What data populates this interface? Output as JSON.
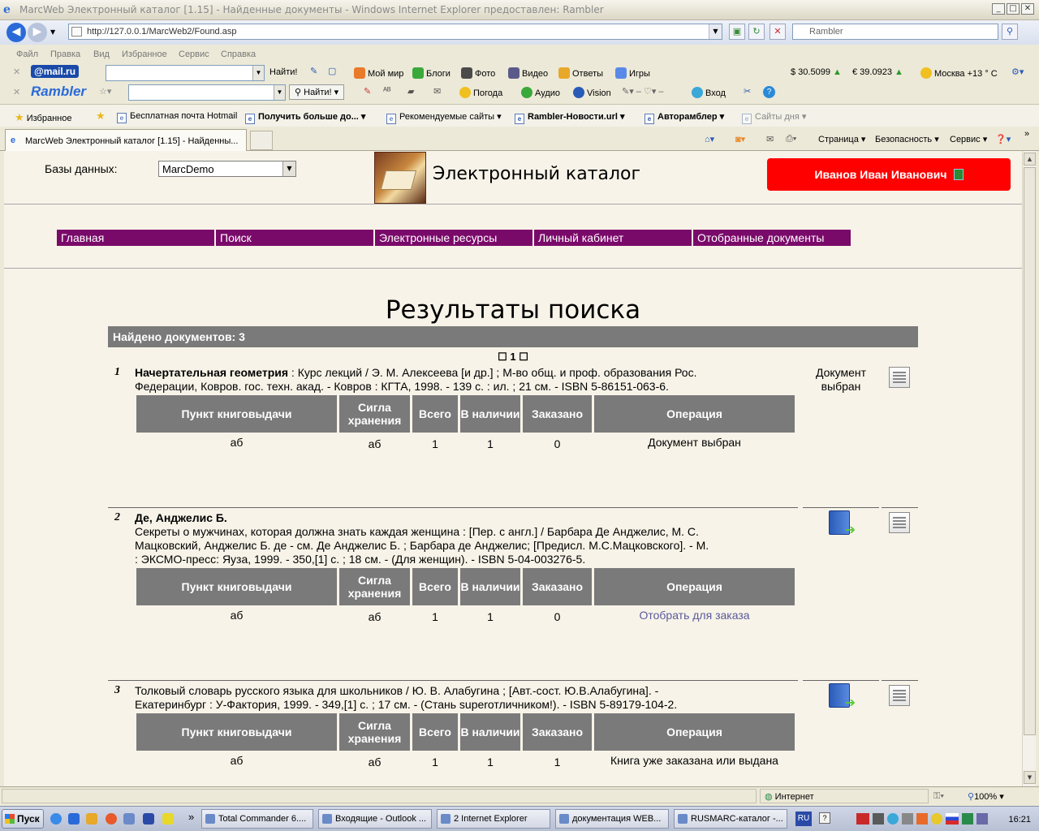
{
  "window": {
    "title": "MarcWeb Электронный каталог [1.15] - Найденные документы - Windows Internet Explorer предоставлен: Rambler",
    "minimize": "_",
    "maximize": "□",
    "close": "✕"
  },
  "address_bar": {
    "url": "http://127.0.0.1/MarcWeb2/Found.asp",
    "search_placeholder": "Rambler"
  },
  "menu": [
    "Файл",
    "Правка",
    "Вид",
    "Избранное",
    "Сервис",
    "Справка"
  ],
  "toolbar1": {
    "brand": "@mail.ru",
    "find": "Найти!",
    "links": [
      "Мой мир",
      "Блоги",
      "Фото",
      "Видео",
      "Ответы",
      "Игры"
    ],
    "usd": "$ 30.5099",
    "eur": "€ 39.0923",
    "weather": "Москва +13 ° C"
  },
  "toolbar2": {
    "brand": "Rambler",
    "find": "Найти!",
    "links": [
      "Погода",
      "Аудио",
      "Vision"
    ],
    "login": "Вход"
  },
  "favorites": {
    "label": "Избранное",
    "items": [
      "Бесплатная почта Hotmail",
      "Получить больше до...",
      "Рекомендуемые сайты",
      "Rambler-Новости.url",
      "Авторамблер",
      "Сайты дня"
    ]
  },
  "tab": {
    "title": "MarcWeb Электронный каталог [1.15] - Найденны..."
  },
  "commandbar": [
    "Страница",
    "Безопасность",
    "Сервис"
  ],
  "page": {
    "db_label": "Базы данных:",
    "db_value": "MarcDemo",
    "catalog_title": "Электронный каталог",
    "user_name": "Иванов Иван Иванович",
    "nav": [
      "Главная",
      "Поиск",
      "Электронные ресурсы",
      "Личный кабинет",
      "Отобранные документы"
    ],
    "results_title": "Результаты поиска",
    "found": "Найдено документов: 3",
    "pager": "☐ 1 ☐",
    "table_headers": {
      "point": "Пункт книговыдачи",
      "sigla": "Сигла хранения",
      "total": "Всего",
      "available": "В наличии",
      "ordered": "Заказано",
      "operation": "Операция"
    },
    "records": [
      {
        "num": "1",
        "title": "Начертательная геометрия",
        "text_line1": " : Курс лекций / Э. М. Алексеева [и др.] ; М-во общ. и проф. образования Рос.",
        "text_line2": "Федерации, Ковров. гос. техн. акад. - Ковров : КГТА, 1998. - 139 с. : ил. ; 21 см. - ISBN 5-86151-063-6.",
        "status": "Документ выбран",
        "row": {
          "point": "аб",
          "sigla": "аб",
          "total": "1",
          "available": "1",
          "ordered": "0",
          "operation": "Документ выбран"
        }
      },
      {
        "num": "2",
        "title": "Де, Анджелис Б.",
        "text_line1": "Секреты о мужчинах, которая должна знать каждая женщина : [Пер. с англ.] / Барбара Де Анджелис, М. С.",
        "text_line2": "Мацковский, Анджелис Б. де - см. Де Анджелис Б. ; Барбара де Анджелис; [Предисл. М.С.Мацковского]. - М.",
        "text_line3": ": ЭКСМО-пресс: Яуза, 1999. - 350,[1] с. ; 18 см. - (Для женщин). - ISBN 5-04-003276-5.",
        "row": {
          "point": "аб",
          "sigla": "аб",
          "total": "1",
          "available": "1",
          "ordered": "0",
          "operation": "Отобрать для заказа"
        }
      },
      {
        "num": "3",
        "text_line1": "Толковый словарь русского языка для школьников / Ю. В. Алабугина ; [Авт.-сост. Ю.В.Алабугина]. -",
        "text_line2": "Екатеринбург : У-Фактория, 1999. - 349,[1] с. ; 17 см. - (Стань superотличником!). - ISBN 5-89179-104-2.",
        "row": {
          "point": "аб",
          "sigla": "аб",
          "total": "1",
          "available": "1",
          "ordered": "1",
          "operation": "Книга уже заказана или выдана"
        }
      }
    ]
  },
  "status": {
    "zone": "Интернет",
    "zoom": "100%"
  },
  "taskbar": {
    "start": "Пуск",
    "tasks": [
      "Total Commander 6....",
      "Входящие - Outlook ...",
      "2 Internet Explorer",
      "документация WEB...",
      "RUSMARC-каталог -..."
    ],
    "lang": "RU",
    "clock": "16:21"
  },
  "colors": {
    "nav_bg": "#7a0a6a",
    "user_button": "#ff0000",
    "table_header": "#7a7a7a",
    "page_bg": "#f7f3e8"
  }
}
